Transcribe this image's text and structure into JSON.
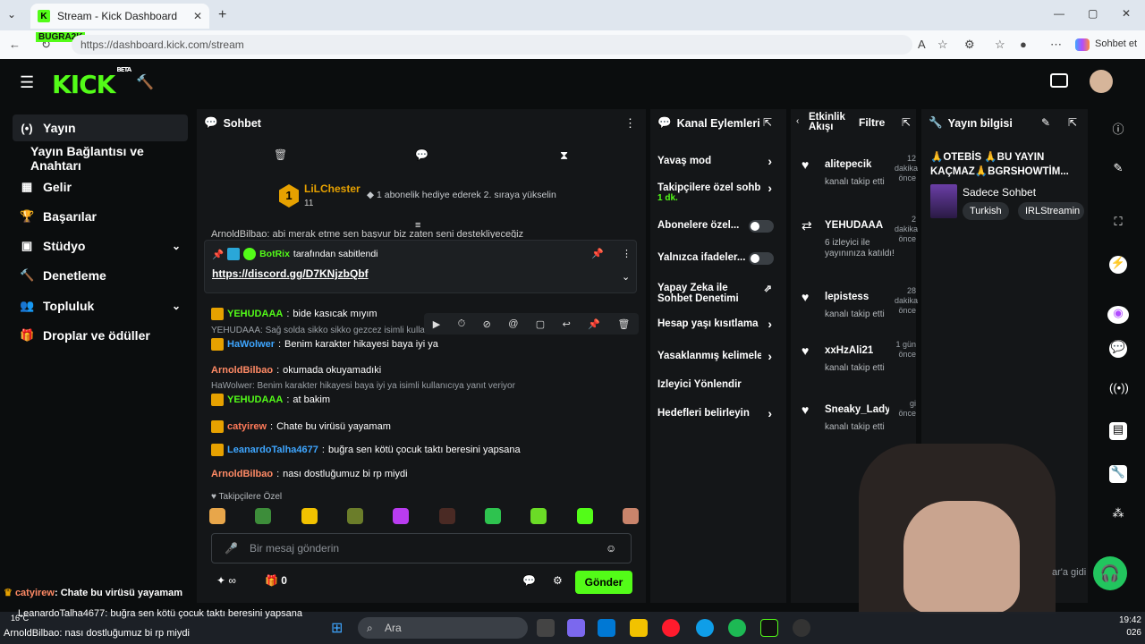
{
  "browser": {
    "tab_title": "Stream - Kick Dashboard",
    "url": "https://dashboard.kick.com/stream",
    "profile_label": "BUGRA2K",
    "sohbet_et": "Sohbet et"
  },
  "app": {
    "logo": "KICK",
    "logo_beta": "BETA"
  },
  "sidebar": {
    "items": [
      {
        "icon": "(•)",
        "label": "Yayın"
      },
      {
        "icon": "",
        "label": "Yayın Bağlantısı ve Anahtarı"
      },
      {
        "icon": "▦",
        "label": "Gelir"
      },
      {
        "icon": "🏆",
        "label": "Başarılar"
      },
      {
        "icon": "▣",
        "label": "Stüdyo"
      },
      {
        "icon": "🔨",
        "label": "Denetleme"
      },
      {
        "icon": "👥",
        "label": "Topluluk"
      },
      {
        "icon": "🎁",
        "label": "Droplar ve ödüller"
      }
    ]
  },
  "chat": {
    "title": "Sohbet",
    "top_user": {
      "rank": "1",
      "name": "LiLChester",
      "count": "11"
    },
    "hint": "1 abonelik hediye ederek 2. sıraya yükselin",
    "truncated_line": "ArnoldBilbao: abi merak etme sen başvur biz zaten seni destekliyeceğiz",
    "pinned": {
      "by_user": "BotRix",
      "by_text": "tarafından sabitlendi",
      "link": "https://discord.gg/D7KNjzbQbf"
    },
    "messages": [
      {
        "reply": "",
        "user": "YEHUDAAA",
        "color": "#53fc18",
        "text": "bide kasıcak mıyım"
      },
      {
        "reply": "YEHUDAAA: Sağ solda sikko sikko gezcez isimli kullanıcıya yanıt veriyor",
        "user": "HaWolwer",
        "color": "#3ea6ff",
        "text": "Benim karakter hikayesi baya iyi ya"
      },
      {
        "reply": "",
        "user": "ArnoldBilbao",
        "color": "#ff8a65",
        "text": "okumada okuyamadıki"
      },
      {
        "reply": "HaWolwer: Benim karakter hikayesi baya iyi ya isimli kullanıcıya yanıt veriyor",
        "user": "YEHUDAAA",
        "color": "#53fc18",
        "text": "at bakim"
      },
      {
        "reply": "",
        "user": "catyirew",
        "color": "#ff7a59",
        "text": "Chate bu virüsü yayamam"
      },
      {
        "reply": "",
        "user": "LeanardoTalha4677",
        "color": "#3ea6ff",
        "text": "buğra sen kötü çocuk taktı beresini yapsana"
      },
      {
        "reply": "",
        "user": "ArnoldBilbao",
        "color": "#ff8a65",
        "text": "nası dostluğumuz bi rp miydi"
      }
    ],
    "followers_only": "Takipçilere Özel",
    "input_placeholder": "Bir mesaj gönderin",
    "infinity": "∞",
    "points": "0",
    "send": "Gönder"
  },
  "actions": {
    "title": "Kanal Eylemleri",
    "items": [
      {
        "label": "Yavaş mod",
        "sub": "",
        "ctrl": "arrow"
      },
      {
        "label": "Takipçilere özel sohb",
        "sub": "1 dk.",
        "ctrl": "arrow"
      },
      {
        "label": "Abonelere özel...",
        "sub": "",
        "ctrl": "toggle"
      },
      {
        "label": "Yalnızca ifadeler...",
        "sub": "",
        "ctrl": "toggle"
      },
      {
        "label": "Yapay Zeka ile Sohbet Denetimi",
        "sub": "",
        "ctrl": "external"
      },
      {
        "label": "Hesap yaşı kısıtlama",
        "sub": "",
        "ctrl": "arrow"
      },
      {
        "label": "Yasaklanmış kelimele",
        "sub": "",
        "ctrl": "arrow"
      },
      {
        "label": "İzleyici Yönlendir",
        "sub": "",
        "ctrl": ""
      },
      {
        "label": "Hedefleri belirleyin",
        "sub": "",
        "ctrl": "arrow"
      }
    ]
  },
  "feed": {
    "title": "Etkinlik Akışı",
    "filter": "Filtre",
    "events": [
      {
        "icon": "♥",
        "name": "alitepecik",
        "time": "12 dakika önce",
        "desc": "kanalı takip etti",
        "desc_color": "#b5b9bd"
      },
      {
        "icon": "⇄",
        "name": "YEHUDAAA",
        "time": "2 dakika önce",
        "desc": "6 izleyici ile yayınınıza katıldı!",
        "desc_color": "#b5b9bd"
      },
      {
        "icon": "♥",
        "name": "lepistess",
        "time": "28 dakika önce",
        "desc": "kanalı takip etti",
        "desc_color": "#b5b9bd"
      },
      {
        "icon": "♥",
        "name": "xxHzAli21",
        "time": "1 gün önce",
        "desc": "kanalı takip etti",
        "desc_color": "#b5b9bd"
      },
      {
        "icon": "♥",
        "name": "Sneaky_Lady",
        "time": "gi önce",
        "desc": "kanalı takip etti",
        "desc_color": "#b5b9bd"
      }
    ]
  },
  "info": {
    "title": "Yayın bilgisi",
    "stream_title": "🙏OTEBİS 🙏BU YAYIN KAÇMAZ🙏BGRSHOWTİM...",
    "category": "Sadece Sohbet",
    "tags": [
      "Turkish",
      "IRLStreamin"
    ]
  },
  "overlay": {
    "line1_user": "catyirew",
    "line1_text": ": Chate bu virüsü yayamam",
    "line2": "LeanardoTalha4677: buğra sen kötü çocuk taktı beresini yapsana",
    "line3": "ArnoldBilbao: nası dostluğumuz bi rp miydi",
    "temp": "16°C",
    "side_text": "ar'a gidi"
  },
  "taskbar": {
    "search": "Ara",
    "time": "19:42",
    "date": "026"
  },
  "colors": {
    "kick_green": "#53fc18",
    "panel": "#141618",
    "bg": "#0b0d0e"
  }
}
